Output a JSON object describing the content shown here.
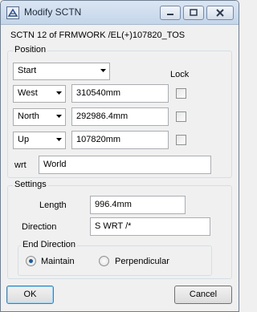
{
  "window": {
    "title": "Modify SCTN",
    "app_icon": "aveva-window-icon",
    "title_buttons": [
      "minimize-icon",
      "maximize-icon",
      "close-icon"
    ]
  },
  "subtitle": "SCTN 12 of FRMWORK /EL(+)107820_TOS",
  "position": {
    "group_label": "Position",
    "point_select": "Start",
    "lock_label": "Lock",
    "rows": [
      {
        "direction": "West",
        "value": "310540mm",
        "locked": false
      },
      {
        "direction": "North",
        "value": "292986.4mm",
        "locked": false
      },
      {
        "direction": "Up",
        "value": "107820mm",
        "locked": false
      }
    ],
    "wrt_label": "wrt",
    "wrt_value": "World"
  },
  "settings": {
    "group_label": "Settings",
    "length_label": "Length",
    "length_value": "996.4mm",
    "direction_label": "Direction",
    "direction_value": "S WRT /*",
    "end_direction": {
      "group_label": "End Direction",
      "options": [
        "Maintain",
        "Perpendicular"
      ],
      "selected": "Maintain"
    }
  },
  "buttons": {
    "ok": "OK",
    "cancel": "Cancel"
  },
  "colors": {
    "titlebar": "#c4d5ea",
    "dialog_bg": "#f0f0f0",
    "radio_dot": "#1d5a9b"
  }
}
